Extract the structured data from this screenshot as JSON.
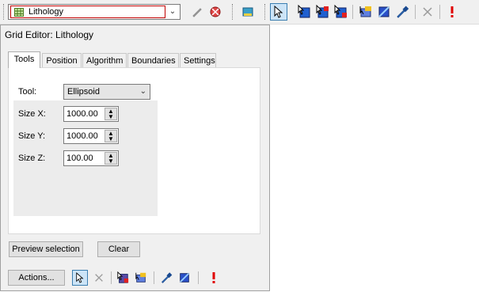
{
  "toolbar": {
    "layer_select": {
      "value": "Lithology",
      "icon": "grid-layer-icon"
    },
    "colors": {
      "accent_red": "#c00000",
      "active_blue": "#cce4f7"
    }
  },
  "panel": {
    "title": "Grid Editor: Lithology",
    "tabs": [
      {
        "label": "Tools",
        "selected": true
      },
      {
        "label": "Position",
        "selected": false
      },
      {
        "label": "Algorithm",
        "selected": false
      },
      {
        "label": "Boundaries",
        "selected": false
      },
      {
        "label": "Settings",
        "selected": false
      }
    ],
    "tool": {
      "label": "Tool:",
      "value": "Ellipsoid"
    },
    "sizes": [
      {
        "label": "Size X:",
        "value": "1000.00"
      },
      {
        "label": "Size Y:",
        "value": "1000.00"
      },
      {
        "label": "Size Z:",
        "value": "100.00"
      }
    ],
    "buttons": {
      "preview": "Preview selection",
      "clear": "Clear",
      "actions": "Actions..."
    }
  }
}
